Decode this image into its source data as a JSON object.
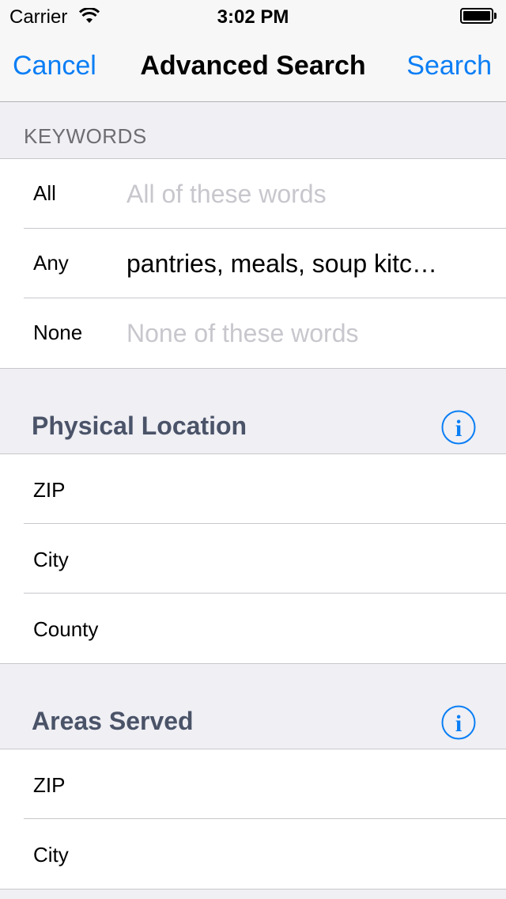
{
  "status_bar": {
    "carrier": "Carrier",
    "time": "3:02 PM",
    "wifi_icon": "wifi-icon",
    "battery_icon": "battery-icon",
    "battery_level": 1.0
  },
  "nav": {
    "cancel_label": "Cancel",
    "title": "Advanced Search",
    "search_label": "Search",
    "accent_color": "#0a7ef5"
  },
  "keywords": {
    "header": "KEYWORDS",
    "rows": [
      {
        "label": "All",
        "value": "",
        "placeholder": "All of these words"
      },
      {
        "label": "Any",
        "value": "pantries, meals, soup kitc…",
        "placeholder": ""
      },
      {
        "label": "None",
        "value": "",
        "placeholder": "None of these words"
      }
    ]
  },
  "physical_location": {
    "header": "Physical Location",
    "info_icon": "info-icon",
    "rows": [
      {
        "label": "ZIP"
      },
      {
        "label": "City"
      },
      {
        "label": "County"
      }
    ]
  },
  "areas_served": {
    "header": "Areas Served",
    "info_icon": "info-icon",
    "rows": [
      {
        "label": "ZIP"
      },
      {
        "label": "City"
      }
    ]
  }
}
